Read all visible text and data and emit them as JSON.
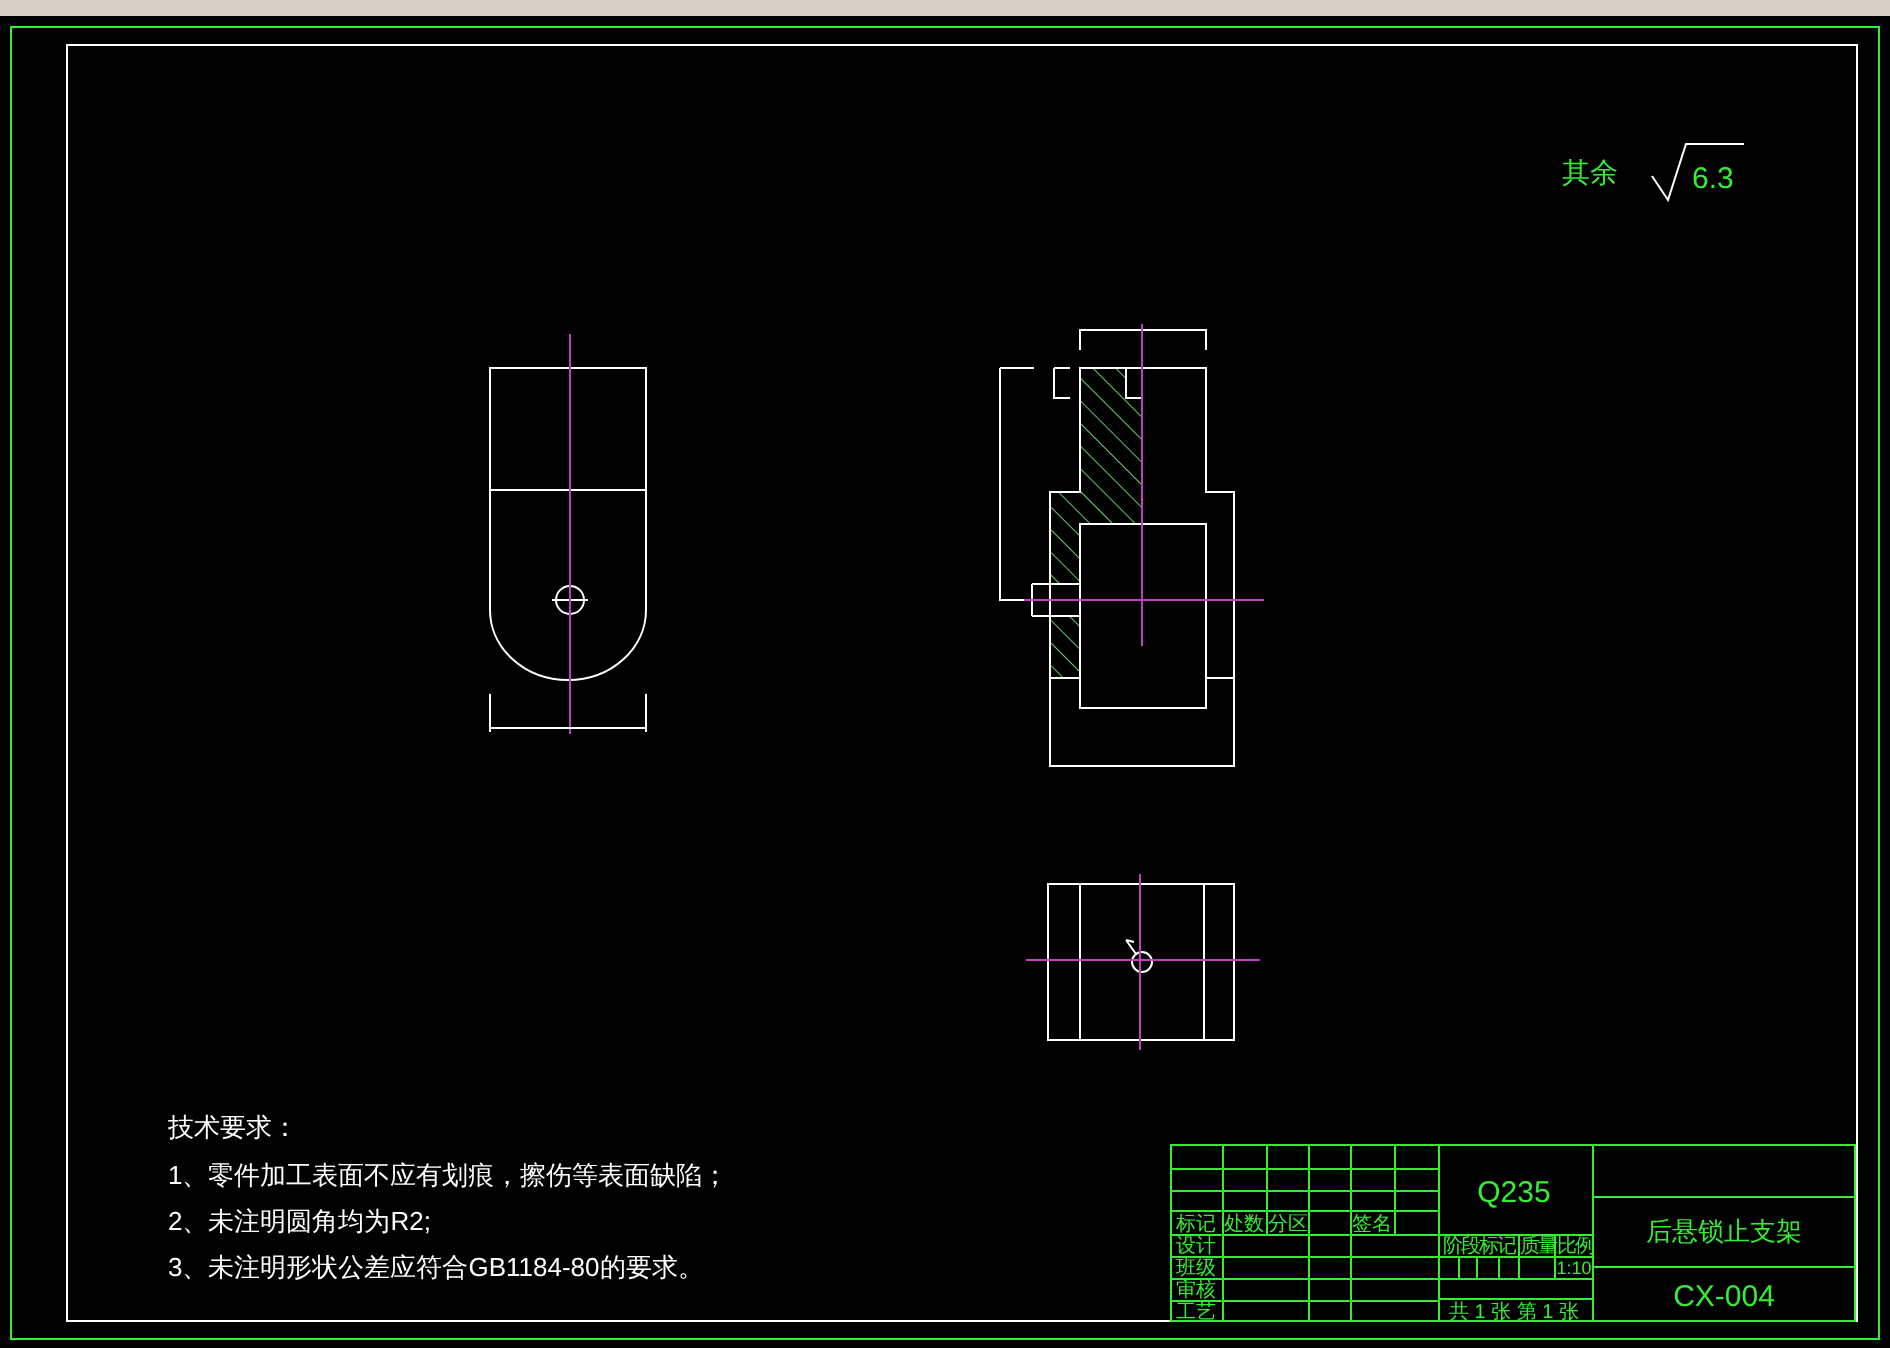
{
  "surface_finish": {
    "label": "其余",
    "value": "6.3"
  },
  "technical_requirements": {
    "heading": "技术要求：",
    "items": [
      "1、零件加工表面不应有划痕，擦伤等表面缺陷；",
      "2、未注明圆角均为R2;",
      "3、未注明形状公差应符合GB1184-80的要求。"
    ]
  },
  "title_block": {
    "material": "Q235",
    "part_name": "后悬锁止支架",
    "drawing_number": "CX-004",
    "scale": "1:10",
    "sheet_info": "共 1 张 第 1 张",
    "labels": [
      "标记",
      "处数",
      "分区",
      "签名",
      "设计",
      "班级",
      "审核",
      "工艺",
      "阶段标记",
      "质量",
      "比例"
    ]
  }
}
